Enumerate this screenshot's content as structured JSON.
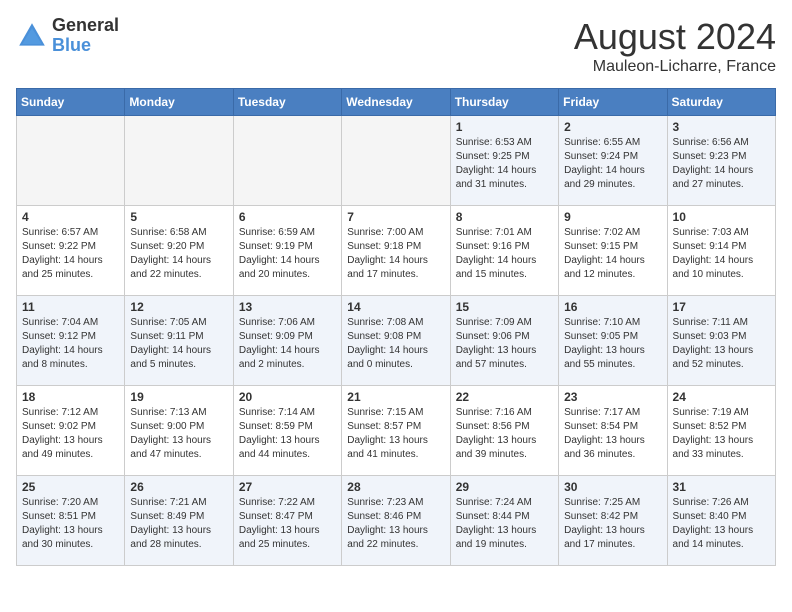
{
  "logo": {
    "general": "General",
    "blue": "Blue"
  },
  "title": "August 2024",
  "subtitle": "Mauleon-Licharre, France",
  "weekdays": [
    "Sunday",
    "Monday",
    "Tuesday",
    "Wednesday",
    "Thursday",
    "Friday",
    "Saturday"
  ],
  "weeks": [
    [
      {
        "day": "",
        "info": ""
      },
      {
        "day": "",
        "info": ""
      },
      {
        "day": "",
        "info": ""
      },
      {
        "day": "",
        "info": ""
      },
      {
        "day": "1",
        "info": "Sunrise: 6:53 AM\nSunset: 9:25 PM\nDaylight: 14 hours and 31 minutes."
      },
      {
        "day": "2",
        "info": "Sunrise: 6:55 AM\nSunset: 9:24 PM\nDaylight: 14 hours and 29 minutes."
      },
      {
        "day": "3",
        "info": "Sunrise: 6:56 AM\nSunset: 9:23 PM\nDaylight: 14 hours and 27 minutes."
      }
    ],
    [
      {
        "day": "4",
        "info": "Sunrise: 6:57 AM\nSunset: 9:22 PM\nDaylight: 14 hours and 25 minutes."
      },
      {
        "day": "5",
        "info": "Sunrise: 6:58 AM\nSunset: 9:20 PM\nDaylight: 14 hours and 22 minutes."
      },
      {
        "day": "6",
        "info": "Sunrise: 6:59 AM\nSunset: 9:19 PM\nDaylight: 14 hours and 20 minutes."
      },
      {
        "day": "7",
        "info": "Sunrise: 7:00 AM\nSunset: 9:18 PM\nDaylight: 14 hours and 17 minutes."
      },
      {
        "day": "8",
        "info": "Sunrise: 7:01 AM\nSunset: 9:16 PM\nDaylight: 14 hours and 15 minutes."
      },
      {
        "day": "9",
        "info": "Sunrise: 7:02 AM\nSunset: 9:15 PM\nDaylight: 14 hours and 12 minutes."
      },
      {
        "day": "10",
        "info": "Sunrise: 7:03 AM\nSunset: 9:14 PM\nDaylight: 14 hours and 10 minutes."
      }
    ],
    [
      {
        "day": "11",
        "info": "Sunrise: 7:04 AM\nSunset: 9:12 PM\nDaylight: 14 hours and 8 minutes."
      },
      {
        "day": "12",
        "info": "Sunrise: 7:05 AM\nSunset: 9:11 PM\nDaylight: 14 hours and 5 minutes."
      },
      {
        "day": "13",
        "info": "Sunrise: 7:06 AM\nSunset: 9:09 PM\nDaylight: 14 hours and 2 minutes."
      },
      {
        "day": "14",
        "info": "Sunrise: 7:08 AM\nSunset: 9:08 PM\nDaylight: 14 hours and 0 minutes."
      },
      {
        "day": "15",
        "info": "Sunrise: 7:09 AM\nSunset: 9:06 PM\nDaylight: 13 hours and 57 minutes."
      },
      {
        "day": "16",
        "info": "Sunrise: 7:10 AM\nSunset: 9:05 PM\nDaylight: 13 hours and 55 minutes."
      },
      {
        "day": "17",
        "info": "Sunrise: 7:11 AM\nSunset: 9:03 PM\nDaylight: 13 hours and 52 minutes."
      }
    ],
    [
      {
        "day": "18",
        "info": "Sunrise: 7:12 AM\nSunset: 9:02 PM\nDaylight: 13 hours and 49 minutes."
      },
      {
        "day": "19",
        "info": "Sunrise: 7:13 AM\nSunset: 9:00 PM\nDaylight: 13 hours and 47 minutes."
      },
      {
        "day": "20",
        "info": "Sunrise: 7:14 AM\nSunset: 8:59 PM\nDaylight: 13 hours and 44 minutes."
      },
      {
        "day": "21",
        "info": "Sunrise: 7:15 AM\nSunset: 8:57 PM\nDaylight: 13 hours and 41 minutes."
      },
      {
        "day": "22",
        "info": "Sunrise: 7:16 AM\nSunset: 8:56 PM\nDaylight: 13 hours and 39 minutes."
      },
      {
        "day": "23",
        "info": "Sunrise: 7:17 AM\nSunset: 8:54 PM\nDaylight: 13 hours and 36 minutes."
      },
      {
        "day": "24",
        "info": "Sunrise: 7:19 AM\nSunset: 8:52 PM\nDaylight: 13 hours and 33 minutes."
      }
    ],
    [
      {
        "day": "25",
        "info": "Sunrise: 7:20 AM\nSunset: 8:51 PM\nDaylight: 13 hours and 30 minutes."
      },
      {
        "day": "26",
        "info": "Sunrise: 7:21 AM\nSunset: 8:49 PM\nDaylight: 13 hours and 28 minutes."
      },
      {
        "day": "27",
        "info": "Sunrise: 7:22 AM\nSunset: 8:47 PM\nDaylight: 13 hours and 25 minutes."
      },
      {
        "day": "28",
        "info": "Sunrise: 7:23 AM\nSunset: 8:46 PM\nDaylight: 13 hours and 22 minutes."
      },
      {
        "day": "29",
        "info": "Sunrise: 7:24 AM\nSunset: 8:44 PM\nDaylight: 13 hours and 19 minutes."
      },
      {
        "day": "30",
        "info": "Sunrise: 7:25 AM\nSunset: 8:42 PM\nDaylight: 13 hours and 17 minutes."
      },
      {
        "day": "31",
        "info": "Sunrise: 7:26 AM\nSunset: 8:40 PM\nDaylight: 13 hours and 14 minutes."
      }
    ]
  ]
}
